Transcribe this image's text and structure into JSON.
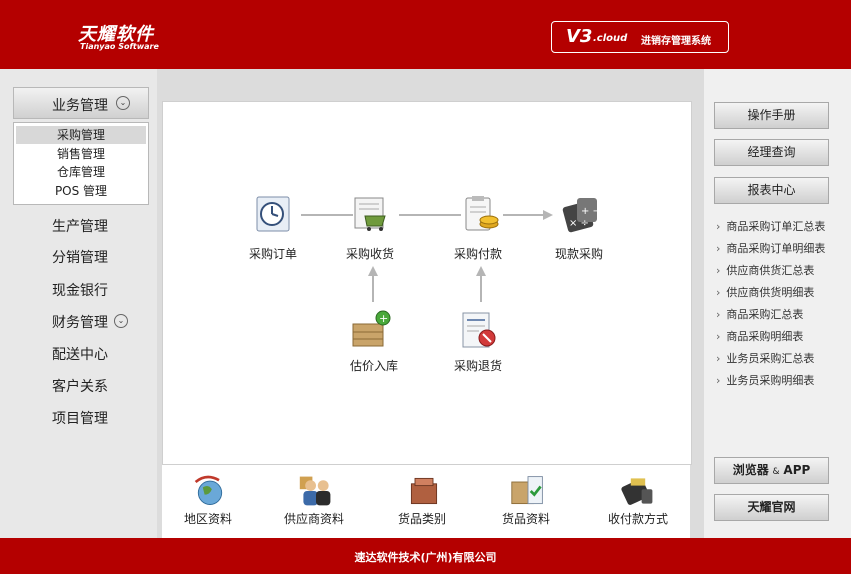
{
  "header": {
    "logo_cn": "天耀软件",
    "logo_en": "Tianyao Software",
    "version_main": "V3",
    "version_sub": ".cloud",
    "system_name": "进销存管理系统"
  },
  "sidebar": {
    "header_label": "业务管理",
    "sub_items": [
      "采购管理",
      "销售管理",
      "仓库管理",
      "POS 管理"
    ],
    "items": [
      "生产管理",
      "分销管理",
      "现金银行",
      "财务管理",
      "配送中心",
      "客户关系",
      "项目管理"
    ]
  },
  "flow": {
    "purchase_order": "采购订单",
    "purchase_receive": "采购收货",
    "purchase_payment": "采购付款",
    "cash_purchase": "现款采购",
    "estimate_stockin": "估价入库",
    "purchase_return": "采购退货"
  },
  "bottom_bar": [
    "地区资料",
    "供应商资料",
    "货品类别",
    "货品资料",
    "收付款方式"
  ],
  "right_panel": {
    "manual_button": "操作手册",
    "manager_query_button": "经理查询",
    "report_center_button": "报表中心",
    "reports": [
      "商品采购订单汇总表",
      "商品采购订单明细表",
      "供应商供货汇总表",
      "供应商供货明细表",
      "商品采购汇总表",
      "商品采购明细表",
      "业务员采购汇总表",
      "业务员采购明细表"
    ],
    "browser_app_part1": "浏览器",
    "browser_app_amp": "&",
    "browser_app_part2": "APP",
    "official_site_button": "天耀官网"
  },
  "footer": {
    "company": "速达软件技术(广州)有限公司"
  },
  "colors": {
    "brand_red": "#b40000"
  },
  "icons": [
    "clock-document-icon",
    "cart-receipt-icon",
    "clipboard-coins-icon",
    "calculator-icon",
    "boxes-plus-icon",
    "return-form-icon",
    "globe-arrow-icon",
    "people-icon",
    "box-icon",
    "package-check-icon",
    "card-terminal-icon"
  ]
}
